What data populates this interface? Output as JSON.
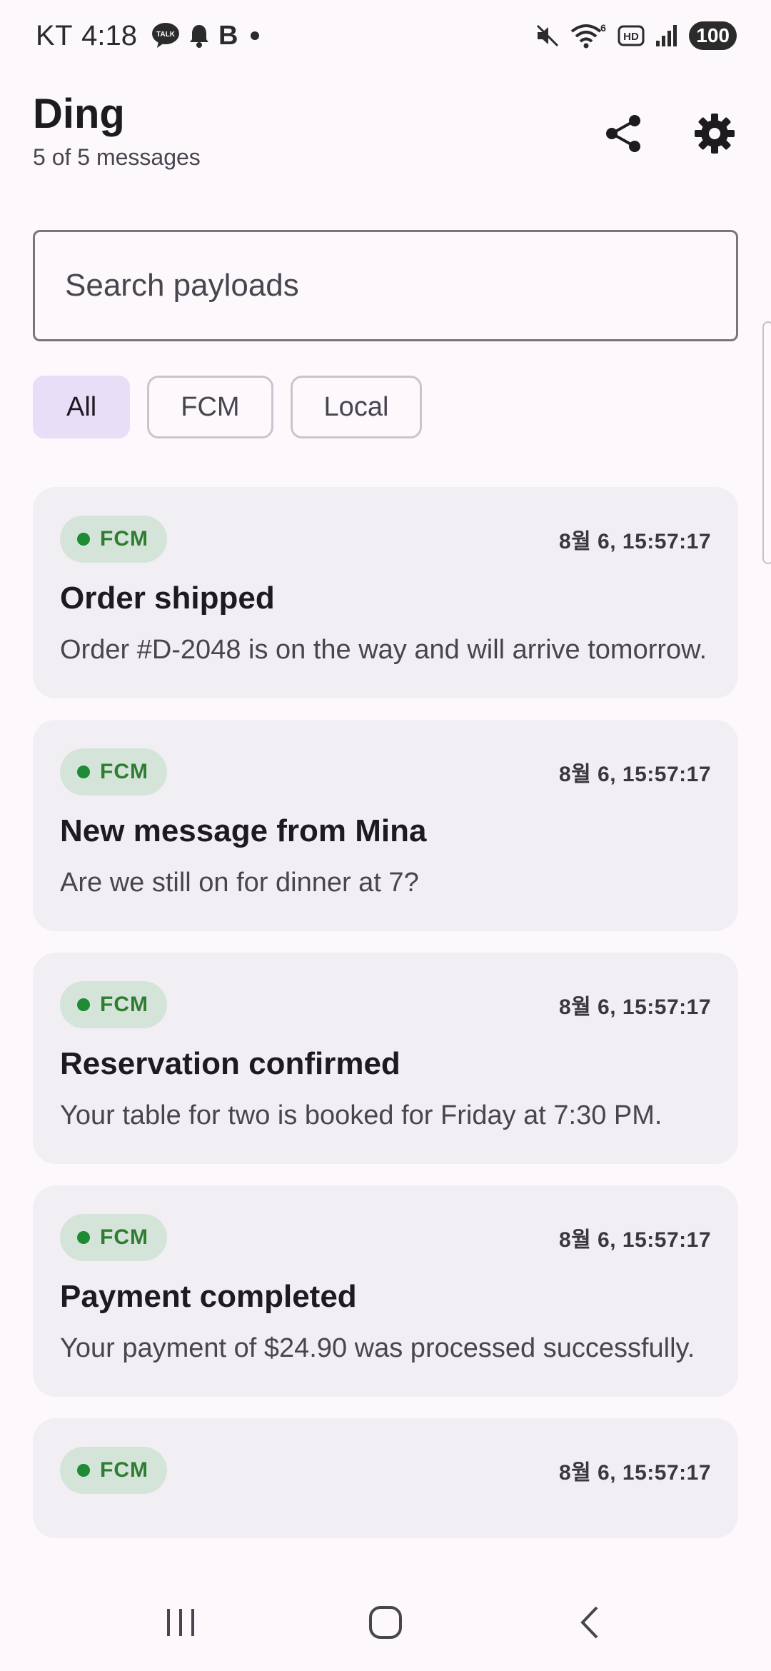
{
  "status_bar": {
    "carrier": "KT",
    "time": "4:18",
    "talk_icon_text": "TALK",
    "b_icon": "B",
    "battery": "100",
    "icons": [
      "talk-icon",
      "notification-bell-icon",
      "b-icon",
      "dot-icon",
      "mute-icon",
      "wifi-6-icon",
      "hd-icon",
      "signal-icon",
      "battery-icon"
    ]
  },
  "header": {
    "title": "Ding",
    "subtitle": "5 of 5 messages",
    "share_icon": "share-icon",
    "settings_icon": "gear-icon"
  },
  "search": {
    "placeholder": "Search payloads",
    "value": ""
  },
  "filters": {
    "chips": [
      {
        "label": "All",
        "selected": true
      },
      {
        "label": "FCM",
        "selected": false
      },
      {
        "label": "Local",
        "selected": false
      }
    ]
  },
  "messages": [
    {
      "source": "FCM",
      "timestamp": "8월 6, 15:57:17",
      "title": "Order shipped",
      "body": "Order #D-2048 is on the way and will arrive tomorrow."
    },
    {
      "source": "FCM",
      "timestamp": "8월 6, 15:57:17",
      "title": "New message from Mina",
      "body": "Are we still on for dinner at 7?"
    },
    {
      "source": "FCM",
      "timestamp": "8월 6, 15:57:17",
      "title": "Reservation confirmed",
      "body": "Your table for two is booked for Friday at 7:30 PM."
    },
    {
      "source": "FCM",
      "timestamp": "8월 6, 15:57:17",
      "title": "Payment completed",
      "body": "Your payment of $24.90 was processed successfully."
    },
    {
      "source": "FCM",
      "timestamp": "8월 6, 15:57:17",
      "title": "",
      "body": ""
    }
  ],
  "colors": {
    "background": "#fcf8fc",
    "card": "#f2eff4",
    "chip_selected": "#e8def8",
    "badge_bg": "#d5e4d8",
    "badge_text": "#2e7d32"
  },
  "nav_bar": {
    "icons": [
      "recents-icon",
      "home-icon",
      "back-icon"
    ]
  }
}
